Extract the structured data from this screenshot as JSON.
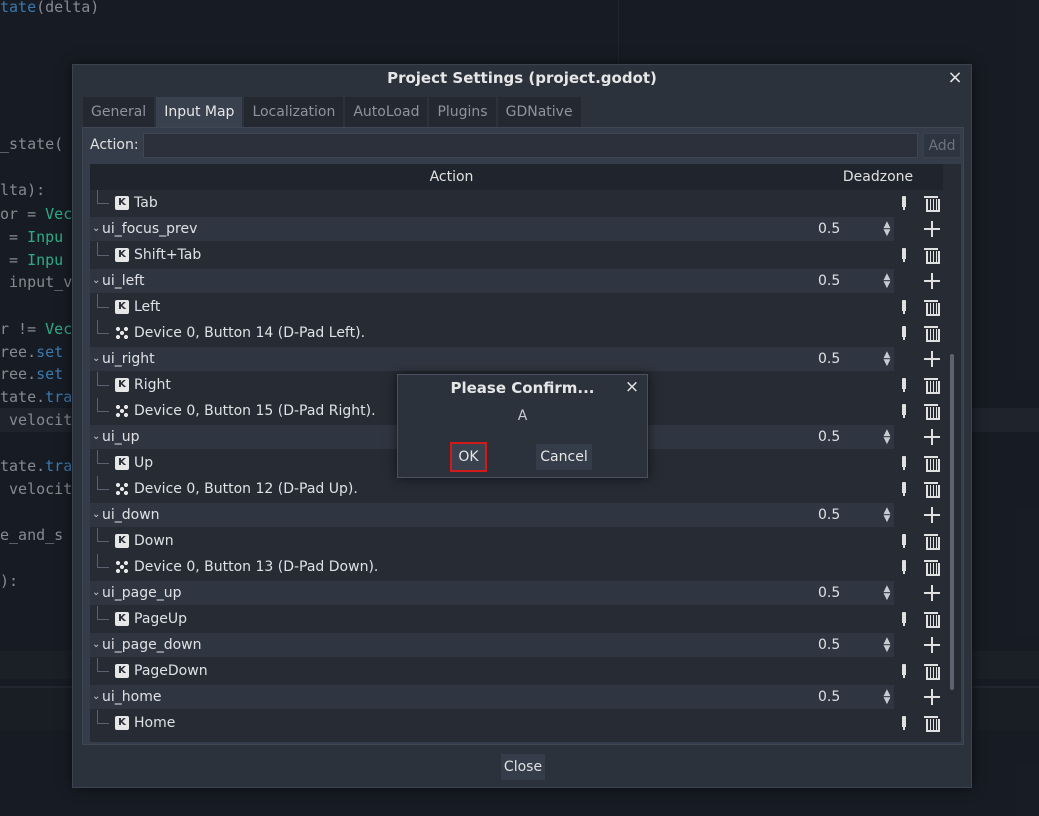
{
  "editor": {
    "lines": [
      {
        "pre": "",
        "fn": "tate",
        "post": "(delta)"
      },
      {
        "pre": "_state(",
        "fn": "",
        "post": ""
      },
      {
        "pre": "lta):",
        "fn": "",
        "post": ""
      },
      {
        "pre": "or = ",
        "ty": "Vec",
        "post": ""
      },
      {
        "pre": " = ",
        "ty": "Inpu",
        "post": ""
      },
      {
        "pre": " = ",
        "ty": "Inpu",
        "post": ""
      },
      {
        "pre": " input_v",
        "fn": "",
        "post": ""
      },
      {
        "pre": "r != ",
        "ty": "Vec",
        "post": ""
      },
      {
        "pre": "ree.",
        "fn": "set",
        "post": ""
      },
      {
        "pre": "ree.",
        "fn": "set",
        "post": ""
      },
      {
        "pre": "tate.",
        "fn": "tra",
        "post": ""
      },
      {
        "pre": " velocit",
        "fn": "",
        "post": ""
      },
      {
        "pre": "tate.",
        "fn": "tra",
        "post": ""
      },
      {
        "pre": " velocit",
        "fn": "",
        "post": ""
      },
      {
        "pre": "e_and_s",
        "fn": "",
        "post": ""
      },
      {
        "pre": "):",
        "fn": "",
        "post": ""
      }
    ]
  },
  "settings": {
    "title": "Project Settings (project.godot)",
    "close_icon": "×",
    "tabs": [
      "General",
      "Input Map",
      "Localization",
      "AutoLoad",
      "Plugins",
      "GDNative"
    ],
    "active_tab": "Input Map",
    "action_label": "Action:",
    "action_value": "",
    "add_label": "Add",
    "columns": {
      "action": "Action",
      "deadzone": "Deadzone"
    },
    "rows": [
      {
        "kind": "event",
        "icon": "keyboard",
        "label": "Tab"
      },
      {
        "kind": "action",
        "label": "ui_focus_prev",
        "deadzone": "0.5"
      },
      {
        "kind": "event",
        "icon": "keyboard",
        "label": "Shift+Tab"
      },
      {
        "kind": "action",
        "label": "ui_left",
        "deadzone": "0.5"
      },
      {
        "kind": "event",
        "icon": "keyboard",
        "label": "Left"
      },
      {
        "kind": "event",
        "icon": "joypad",
        "label": "Device 0, Button 14 (D-Pad Left)."
      },
      {
        "kind": "action",
        "label": "ui_right",
        "deadzone": "0.5"
      },
      {
        "kind": "event",
        "icon": "keyboard",
        "label": "Right"
      },
      {
        "kind": "event",
        "icon": "joypad",
        "label": "Device 0, Button 15 (D-Pad Right)."
      },
      {
        "kind": "action",
        "label": "ui_up",
        "deadzone": "0.5"
      },
      {
        "kind": "event",
        "icon": "keyboard",
        "label": "Up"
      },
      {
        "kind": "event",
        "icon": "joypad",
        "label": "Device 0, Button 12 (D-Pad Up)."
      },
      {
        "kind": "action",
        "label": "ui_down",
        "deadzone": "0.5"
      },
      {
        "kind": "event",
        "icon": "keyboard",
        "label": "Down"
      },
      {
        "kind": "event",
        "icon": "joypad",
        "label": "Device 0, Button 13 (D-Pad Down)."
      },
      {
        "kind": "action",
        "label": "ui_page_up",
        "deadzone": "0.5"
      },
      {
        "kind": "event",
        "icon": "keyboard",
        "label": "PageUp"
      },
      {
        "kind": "action",
        "label": "ui_page_down",
        "deadzone": "0.5"
      },
      {
        "kind": "event",
        "icon": "keyboard",
        "label": "PageDown"
      },
      {
        "kind": "action",
        "label": "ui_home",
        "deadzone": "0.5"
      },
      {
        "kind": "event",
        "icon": "keyboard",
        "label": "Home"
      }
    ],
    "close_button": "Close"
  },
  "confirm": {
    "title": "Please Confirm...",
    "close_icon": "×",
    "text": "A",
    "ok_label": "OK",
    "cancel_label": "Cancel",
    "ok_highlight_color": "#d11a1a"
  }
}
